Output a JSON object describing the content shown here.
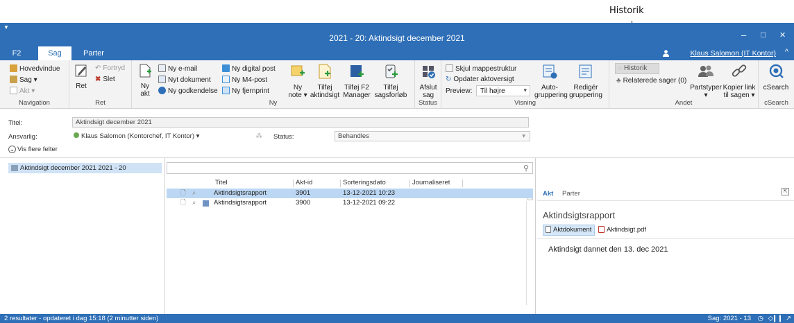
{
  "callout": {
    "label": "Historik"
  },
  "window": {
    "title": "2021 - 20: Aktindsigt december 2021",
    "menu_glyph": "▼",
    "minimize": "‒",
    "maximize": "□",
    "close": "✕"
  },
  "tabs": [
    {
      "label": "F2",
      "selected": false
    },
    {
      "label": "Sag",
      "selected": true
    },
    {
      "label": "Parter",
      "selected": false
    }
  ],
  "user": {
    "name": "Klaus Salomon (IT Kontor)",
    "collapse_glyph": "^"
  },
  "ribbon": {
    "navigation": {
      "items": [
        "Hovedvindue",
        "Sag ▾",
        "Akt ▾"
      ],
      "label": "Navigation"
    },
    "ret": {
      "big": "Ret",
      "items": [
        "Fortryd",
        "Slet"
      ],
      "label": "Ret"
    },
    "ny": {
      "ny_akt": [
        "Ny",
        "akt"
      ],
      "col1": [
        "Ny e-mail",
        "Nyt dokument",
        "Ny godkendelse"
      ],
      "col2": [
        "Ny digital post",
        "Ny M4-post",
        "Ny fjernprint"
      ],
      "big": [
        {
          "l1": "Ny",
          "l2": "note ▾"
        },
        {
          "l1": "Tilføj",
          "l2": "aktindsigt"
        },
        {
          "l1": "Tilføj F2",
          "l2": "Manager"
        },
        {
          "l1": "Tilføj",
          "l2": "sagsforløb"
        }
      ],
      "label": "Ny"
    },
    "status": {
      "l1": "Afslut",
      "l2": "sag",
      "label": "Status"
    },
    "visning": {
      "items": [
        "Skjul mappestruktur",
        "Opdater aktoversigt"
      ],
      "preview_label": "Preview:",
      "preview_value": "Til højre",
      "big": [
        {
          "l1": "Auto-",
          "l2": "gruppering"
        },
        {
          "l1": "Redigér",
          "l2": "gruppering"
        }
      ],
      "label": "Visning"
    },
    "andet": {
      "items": [
        "Historik",
        "Relaterede sager (0)"
      ],
      "big": [
        {
          "l1": "Partstyper",
          "l2": "▾"
        },
        {
          "l1": "Kopier link",
          "l2": "til sagen ▾"
        }
      ],
      "label": "Andet"
    },
    "csearch": {
      "big": "cSearch",
      "label": "cSearch"
    }
  },
  "fields": {
    "titel_label": "Titel:",
    "titel_value": "Aktindsigt december 2021",
    "ansvarlig_label": "Ansvarlig:",
    "ansvarlig_value": "Klaus Salomon (Kontorchef, IT Kontor) ▾",
    "status_label": "Status:",
    "status_value": "Behandles",
    "more": "Vis flere felter"
  },
  "tree": {
    "item": "Aktindsigt december 2021 2021 - 20"
  },
  "grid": {
    "search_placeholder": "",
    "columns": [
      "Titel",
      "Akt-id",
      "Sorteringsdato",
      "Journaliseret"
    ],
    "rows": [
      {
        "title": "Aktindsigtsrapport",
        "id": "3901",
        "date": "13-12-2021 10:23",
        "selected": true
      },
      {
        "title": "Aktindsigtsrapport",
        "id": "3900",
        "date": "13-12-2021 09:22",
        "selected": false
      }
    ]
  },
  "preview": {
    "tabs": [
      "Akt",
      "Parter"
    ],
    "title": "Aktindsigtsrapport",
    "doc_tab": "Aktdokument",
    "attachment": "Aktindsigt.pdf",
    "body": "Aktindsigt dannet den 13. dec 2021"
  },
  "statusbar": {
    "left": "2 resultater - opdateret i dag 15:18 (2 minutter siden)",
    "right": "Sag: 2021 - 13"
  },
  "colors": {
    "accent": "#2e6fb7",
    "selection": "#bcd7f3",
    "status_green": "#6aa84f"
  }
}
